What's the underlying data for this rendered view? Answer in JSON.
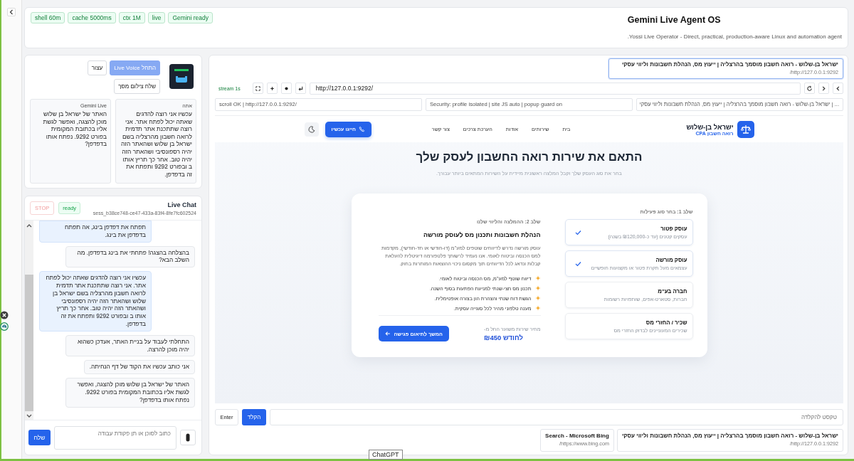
{
  "header": {
    "badges": [
      "Gemini ready",
      "live",
      "ctx 1M",
      "cache 5000ms",
      "shell 60m"
    ],
    "title": "Gemini Live Agent OS",
    "subtitle": "Yossi Live Operator - Direct, practical, production-aware Linux and automation agent."
  },
  "voice_panel": {
    "buttons": [
      {
        "label": "התחל Live Voice",
        "kind": "primary",
        "disabled": true
      },
      {
        "label": "עצור",
        "kind": "plain",
        "disabled": false
      },
      {
        "label": "שלח צילום מסך",
        "kind": "plain",
        "disabled": false
      }
    ],
    "transcripts": [
      {
        "speaker": "אתה",
        "text": "עכשיו אני רוצה להדגים שאתה יכול לפתח אתר. אני רוצה שתתכנת אתר תדמית לרואה חשבון מהרצליה בשם ישראל בן שלוש ושהאתר הזה יהיה רספונסיבי ושהאתר הזה יהיה טוב. אחר כך תריץ אותו ב ובפורט 9292 ותפתח את זה בדפדפן."
      },
      {
        "speaker": "Gemini Live",
        "text": "האתר של ישראל בן שלוש מוכן להצגה, ואפשר לגשת אליו בכתובת המקומית בפורט 9292. נפתח אותו בדפדפן?"
      }
    ]
  },
  "chat": {
    "title": "Live Chat",
    "session": "sess_b38ce748-ce47-433a-83f4-8fe7fc602524",
    "status": "ready",
    "stop_button": "STOP",
    "messages": [
      {
        "kind": "user",
        "text": "תפתח את דפדפן בינג, אה תפתח בדפדפן את בינג."
      },
      {
        "kind": "agent",
        "text": "בהצלחה בהצגה! פתחתי את בינג בדפדפן. מה השלב הבא?"
      },
      {
        "kind": "user",
        "text": "עכשיו אני רוצה להדגים שאתה יכול לפתח אתר. אני רוצה שתתכנת אתר תדמית לרואה חשבון מהרצליה בשם ישראל בן שלוש ושהאתר הזה יהיה רספונסיבי ושהאתר הזה יהיה טוב. אחר כך תריץ אותו ב ובפורט 9292 ותפתח את זה בדפדפן."
      },
      {
        "kind": "agent",
        "text": "התחלתי לעבוד על בניית האתר, אעדכן כשהוא יהיה מוכן להרצה."
      },
      {
        "kind": "agent",
        "text": "אני כותב עכשיו את הקוד של דף הנחיתה."
      },
      {
        "kind": "agent",
        "text": "האתר של ישראל בן שלוש מוכן להצגה, ואפשר לגשת אליו בכתובת המקומית בפורט 9292. נפתח אותו בדפדפן?"
      }
    ],
    "input": {
      "placeholder": "כתוב לסוכן או תן פקודת עבודה"
    },
    "send_button": "שלח"
  },
  "browser": {
    "top_tabs": [
      {
        "title": "ישראל בן-שלוש - רואה חשבון מוסמך בהרצליה | ייעוץ מס, הנהלת חשבונות וליווי עסקי",
        "url": "http://127.0.0.1:9292/",
        "selected": true
      }
    ],
    "stream": "stream 1s",
    "url": "http://127.0.0.1:9292/",
    "info": [
      "... | ישראל בן-שלוש - רואה חשבון מוסמך בהרצליה | ייעוץ מס, הנהלת חשבונות וליווי עסקי",
      "Security: profile isolated | site JS auto | popup guard on",
      "scroll OK | http://127.0.0.1:9292/"
    ],
    "page": {
      "brand": {
        "name": "ישראל בן-שלוש",
        "tagline": "רואה חשבון CPA"
      },
      "nav_links": [
        "בית",
        "שירותים",
        "אודות",
        "הערכת צרכים",
        "צור קשר"
      ],
      "call_button": "חייגו עכשיו",
      "heading": "התאם את שירות רואה החשבון לעסק שלך",
      "subheading": "בחר את סוג העסק שלך וקבל המלצה ראשונית מיידית על השירות המתאים ביותר עבורך.",
      "step1": {
        "label": "שלב 1: בחר סוג פעילות",
        "options": [
          {
            "title": "עוסק פטור",
            "subtitle": "עסקים קטנים (עד כ-₪120,000 בשנה)",
            "checked": true
          },
          {
            "title": "עוסק מורשה",
            "subtitle": "עצמאים מעל תקרת פטור או מקצועות חופשיים",
            "checked": true
          },
          {
            "title": "חברה בע\"מ",
            "subtitle": "חברות, סטארט-אפים, שותפויות רשומות",
            "checked": false
          },
          {
            "title": "שכיר / החזרי מס",
            "subtitle": "שכירים המעוניינים לבדוק החזרי מס",
            "checked": false
          }
        ]
      },
      "step2": {
        "label": "שלב 2: ההמלצה והליווי שלנו",
        "title": "הנהלת חשבונות ותכנון מס לעוסק מורשה",
        "text": "עוסק מורשה נדרש לדיווחים שוטפים למע\"מ (דו-חודשי או חד-חודשי), מקדמות למס הכנסה וביטוח לאומי. אנו נעמיד לרשותך פלטפורמה דיגיטלית להעלאת קבלות ונדאג לכל הדיווחים תוך מקסום ניכוי ההוצאות המותרות בחוק.",
        "features": [
          "דיווח שוטף למע\"מ, מס הכנסה וביטוח לאומי.",
          "תכנון מס חצי-שנתי למניעת הפתעות בסוף השנה.",
          "הגשת דוח שנתי והצהרת הון בצורה אופטימלית.",
          "מענה טלפוני מהיר לכל סוגייה עסקית."
        ],
        "price_label": "מחיר שירות משוער החל מ-",
        "price": "₪450 לחודש",
        "continue_button": "המשך לתיאום פגישה"
      }
    },
    "type_field": {
      "placeholder": "טקסט להקלדה"
    },
    "type_button": "הקלד",
    "enter_button": "Enter",
    "tabs": [
      {
        "title": "ישראל בן-שלוש - רואה חשבון מוסמך בהרצליה | ייעוץ מס, הנהלת חשבונות וליווי עסקי",
        "url": "http://127.0.0.1:9292/",
        "selected": false
      },
      {
        "title": "Search - Microsoft Bing",
        "url": "https://www.bing.com/",
        "selected": false
      }
    ]
  },
  "tooltip": "ChatGPT"
}
